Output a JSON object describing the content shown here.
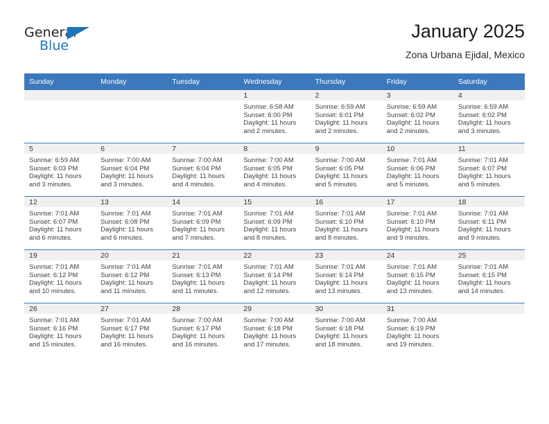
{
  "brand": {
    "name_top": "General",
    "name_bottom": "Blue",
    "accent_color": "#1c75bc"
  },
  "header": {
    "title": "January 2025",
    "location": "Zona Urbana Ejidal, Mexico"
  },
  "calendar": {
    "header_bg": "#3b78bc",
    "daynum_bg": "#f0f0f0",
    "weekdays": [
      "Sunday",
      "Monday",
      "Tuesday",
      "Wednesday",
      "Thursday",
      "Friday",
      "Saturday"
    ],
    "weeks": [
      [
        {
          "day": "",
          "blank": true
        },
        {
          "day": "",
          "blank": true
        },
        {
          "day": "",
          "blank": true
        },
        {
          "day": "1",
          "sunrise": "Sunrise: 6:58 AM",
          "sunset": "Sunset: 6:00 PM",
          "daylight": "Daylight: 11 hours and 2 minutes."
        },
        {
          "day": "2",
          "sunrise": "Sunrise: 6:59 AM",
          "sunset": "Sunset: 6:01 PM",
          "daylight": "Daylight: 11 hours and 2 minutes."
        },
        {
          "day": "3",
          "sunrise": "Sunrise: 6:59 AM",
          "sunset": "Sunset: 6:02 PM",
          "daylight": "Daylight: 11 hours and 2 minutes."
        },
        {
          "day": "4",
          "sunrise": "Sunrise: 6:59 AM",
          "sunset": "Sunset: 6:02 PM",
          "daylight": "Daylight: 11 hours and 3 minutes."
        }
      ],
      [
        {
          "day": "5",
          "sunrise": "Sunrise: 6:59 AM",
          "sunset": "Sunset: 6:03 PM",
          "daylight": "Daylight: 11 hours and 3 minutes."
        },
        {
          "day": "6",
          "sunrise": "Sunrise: 7:00 AM",
          "sunset": "Sunset: 6:04 PM",
          "daylight": "Daylight: 11 hours and 3 minutes."
        },
        {
          "day": "7",
          "sunrise": "Sunrise: 7:00 AM",
          "sunset": "Sunset: 6:04 PM",
          "daylight": "Daylight: 11 hours and 4 minutes."
        },
        {
          "day": "8",
          "sunrise": "Sunrise: 7:00 AM",
          "sunset": "Sunset: 6:05 PM",
          "daylight": "Daylight: 11 hours and 4 minutes."
        },
        {
          "day": "9",
          "sunrise": "Sunrise: 7:00 AM",
          "sunset": "Sunset: 6:05 PM",
          "daylight": "Daylight: 11 hours and 5 minutes."
        },
        {
          "day": "10",
          "sunrise": "Sunrise: 7:01 AM",
          "sunset": "Sunset: 6:06 PM",
          "daylight": "Daylight: 11 hours and 5 minutes."
        },
        {
          "day": "11",
          "sunrise": "Sunrise: 7:01 AM",
          "sunset": "Sunset: 6:07 PM",
          "daylight": "Daylight: 11 hours and 5 minutes."
        }
      ],
      [
        {
          "day": "12",
          "sunrise": "Sunrise: 7:01 AM",
          "sunset": "Sunset: 6:07 PM",
          "daylight": "Daylight: 11 hours and 6 minutes."
        },
        {
          "day": "13",
          "sunrise": "Sunrise: 7:01 AM",
          "sunset": "Sunset: 6:08 PM",
          "daylight": "Daylight: 11 hours and 6 minutes."
        },
        {
          "day": "14",
          "sunrise": "Sunrise: 7:01 AM",
          "sunset": "Sunset: 6:09 PM",
          "daylight": "Daylight: 11 hours and 7 minutes."
        },
        {
          "day": "15",
          "sunrise": "Sunrise: 7:01 AM",
          "sunset": "Sunset: 6:09 PM",
          "daylight": "Daylight: 11 hours and 8 minutes."
        },
        {
          "day": "16",
          "sunrise": "Sunrise: 7:01 AM",
          "sunset": "Sunset: 6:10 PM",
          "daylight": "Daylight: 11 hours and 8 minutes."
        },
        {
          "day": "17",
          "sunrise": "Sunrise: 7:01 AM",
          "sunset": "Sunset: 6:10 PM",
          "daylight": "Daylight: 11 hours and 9 minutes."
        },
        {
          "day": "18",
          "sunrise": "Sunrise: 7:01 AM",
          "sunset": "Sunset: 6:11 PM",
          "daylight": "Daylight: 11 hours and 9 minutes."
        }
      ],
      [
        {
          "day": "19",
          "sunrise": "Sunrise: 7:01 AM",
          "sunset": "Sunset: 6:12 PM",
          "daylight": "Daylight: 11 hours and 10 minutes."
        },
        {
          "day": "20",
          "sunrise": "Sunrise: 7:01 AM",
          "sunset": "Sunset: 6:12 PM",
          "daylight": "Daylight: 11 hours and 11 minutes."
        },
        {
          "day": "21",
          "sunrise": "Sunrise: 7:01 AM",
          "sunset": "Sunset: 6:13 PM",
          "daylight": "Daylight: 11 hours and 11 minutes."
        },
        {
          "day": "22",
          "sunrise": "Sunrise: 7:01 AM",
          "sunset": "Sunset: 6:14 PM",
          "daylight": "Daylight: 11 hours and 12 minutes."
        },
        {
          "day": "23",
          "sunrise": "Sunrise: 7:01 AM",
          "sunset": "Sunset: 6:14 PM",
          "daylight": "Daylight: 11 hours and 13 minutes."
        },
        {
          "day": "24",
          "sunrise": "Sunrise: 7:01 AM",
          "sunset": "Sunset: 6:15 PM",
          "daylight": "Daylight: 11 hours and 13 minutes."
        },
        {
          "day": "25",
          "sunrise": "Sunrise: 7:01 AM",
          "sunset": "Sunset: 6:15 PM",
          "daylight": "Daylight: 11 hours and 14 minutes."
        }
      ],
      [
        {
          "day": "26",
          "sunrise": "Sunrise: 7:01 AM",
          "sunset": "Sunset: 6:16 PM",
          "daylight": "Daylight: 11 hours and 15 minutes."
        },
        {
          "day": "27",
          "sunrise": "Sunrise: 7:01 AM",
          "sunset": "Sunset: 6:17 PM",
          "daylight": "Daylight: 11 hours and 16 minutes."
        },
        {
          "day": "28",
          "sunrise": "Sunrise: 7:00 AM",
          "sunset": "Sunset: 6:17 PM",
          "daylight": "Daylight: 11 hours and 16 minutes."
        },
        {
          "day": "29",
          "sunrise": "Sunrise: 7:00 AM",
          "sunset": "Sunset: 6:18 PM",
          "daylight": "Daylight: 11 hours and 17 minutes."
        },
        {
          "day": "30",
          "sunrise": "Sunrise: 7:00 AM",
          "sunset": "Sunset: 6:18 PM",
          "daylight": "Daylight: 11 hours and 18 minutes."
        },
        {
          "day": "31",
          "sunrise": "Sunrise: 7:00 AM",
          "sunset": "Sunset: 6:19 PM",
          "daylight": "Daylight: 11 hours and 19 minutes."
        },
        {
          "day": "",
          "blank": true
        }
      ]
    ]
  }
}
